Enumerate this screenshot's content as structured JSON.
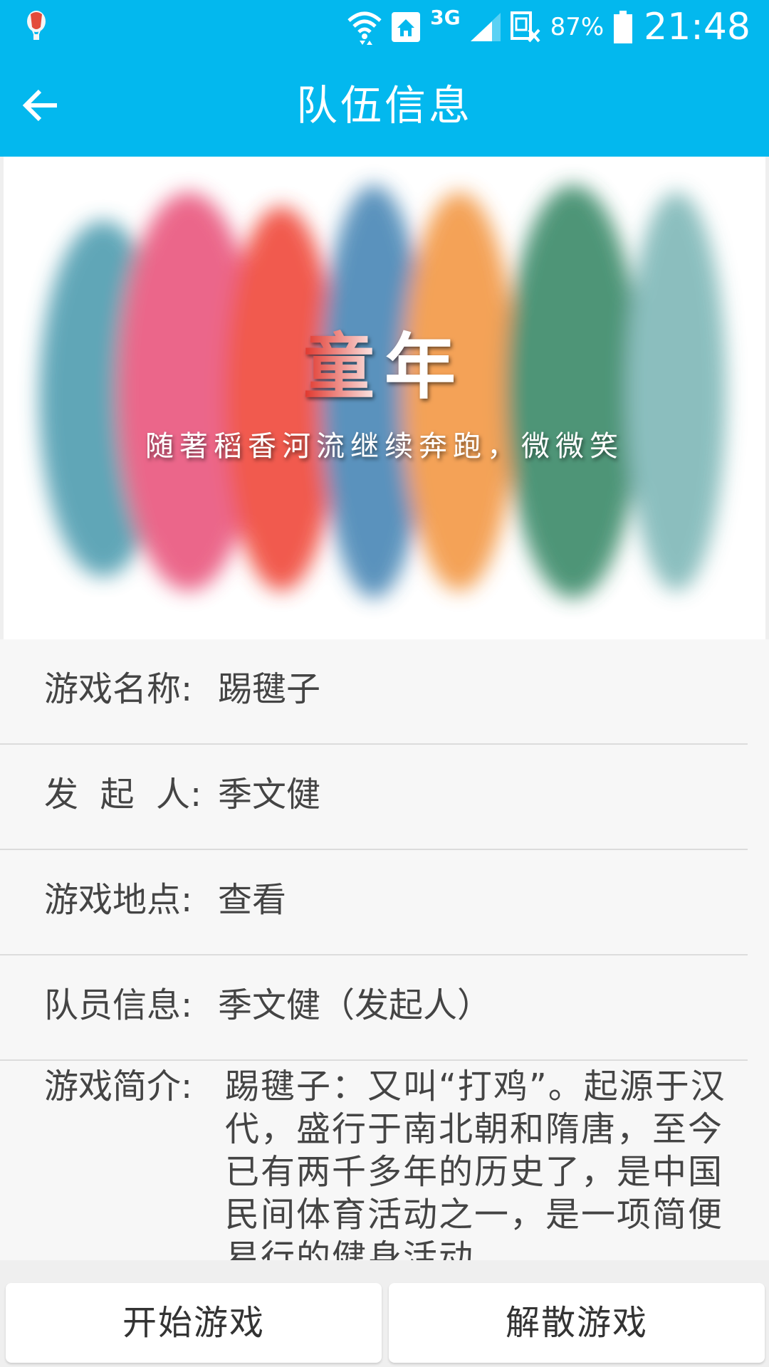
{
  "status_bar": {
    "battery_percent": "87%",
    "network": "3G",
    "time": "21:48",
    "icons": [
      "balloon-icon",
      "wifi-icon",
      "home-icon",
      "signal-icon",
      "sim-icon",
      "battery-icon"
    ]
  },
  "app_bar": {
    "title": "队伍信息",
    "back_icon": "arrow-left-icon"
  },
  "banner": {
    "title": "童年",
    "subtitle": "随著稻香河流继续奔跑，微微笑",
    "colors": [
      "#4f9db0",
      "#e9567e",
      "#f0483a",
      "#4a87b6",
      "#f39845",
      "#3b8a69",
      "#7fb8b8"
    ]
  },
  "info": {
    "game_name": {
      "label": "游戏名称:",
      "value": "踢毽子"
    },
    "initiator": {
      "label": "发  起  人:",
      "value": "季文健"
    },
    "location": {
      "label": "游戏地点:",
      "value": "查看"
    },
    "members": {
      "label": "队员信息:",
      "value": "季文健（发起人）"
    },
    "intro": {
      "label": "游戏简介:",
      "value": "踢毽子：又叫“打鸡”。起源于汉代，盛行于南北朝和隋唐，至今已有两千多年的历史了，是中国民间体育活动之一，是一项简便易行的健身活动。"
    }
  },
  "buttons": {
    "start": "开始游戏",
    "dissolve": "解散游戏"
  }
}
